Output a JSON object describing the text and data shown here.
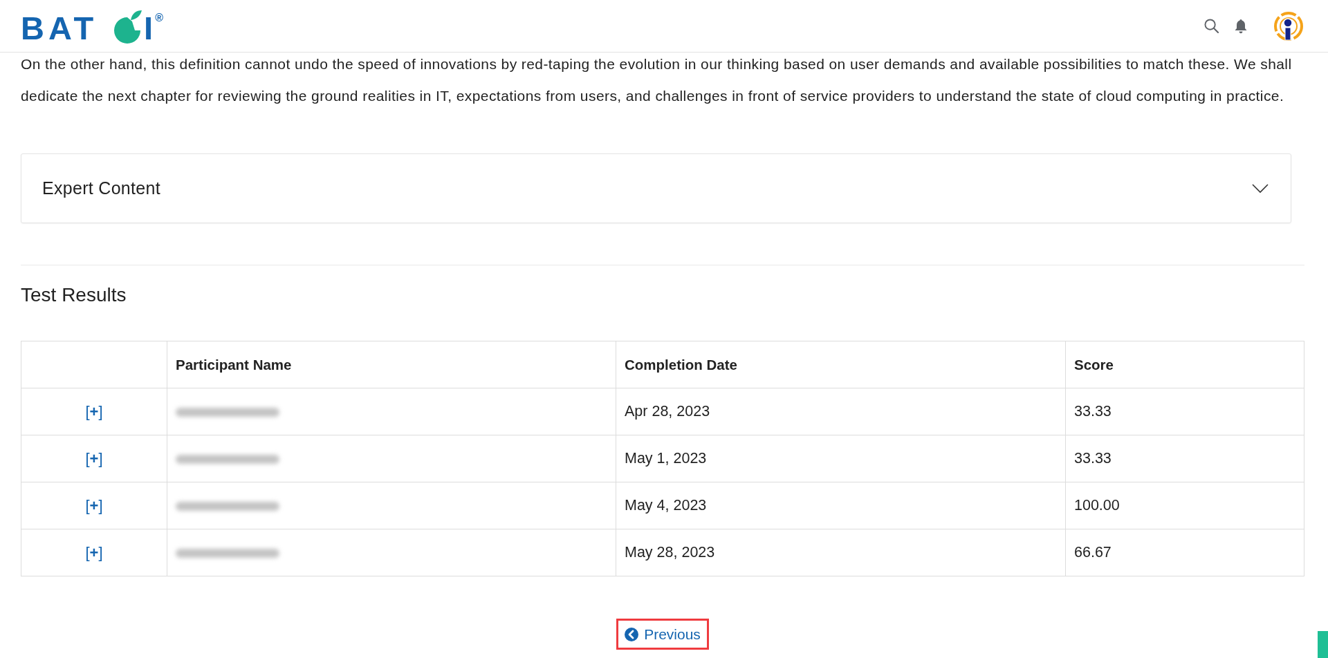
{
  "header": {
    "logo": {
      "left": "BAT",
      "right": "I",
      "mark": "®"
    }
  },
  "paragraph": "On the other hand, this definition cannot undo the speed of innovations by red-taping the evolution in our thinking based on user demands and available possibilities to match these. We shall dedicate the next chapter for reviewing the ground realities in IT, expectations from users, and challenges in front of service providers to understand the state of cloud computing in practice.",
  "accordion": {
    "title": "Expert Content",
    "expanded": false
  },
  "section_title": "Test Results",
  "table": {
    "columns": [
      "Participant Name",
      "Completion Date",
      "Score"
    ],
    "rows": [
      {
        "expand": "[**+**]",
        "name_blurred": true,
        "date": "Apr 28, 2023",
        "score": "33.33"
      },
      {
        "expand": "[**+**]",
        "name_blurred": true,
        "date": "May 1, 2023",
        "score": "33.33"
      },
      {
        "expand": "[**+**]",
        "name_blurred": true,
        "date": "May 4, 2023",
        "score": "100.00"
      },
      {
        "expand": "[**+**]",
        "name_blurred": true,
        "date": "May 28, 2023",
        "score": "66.67"
      }
    ]
  },
  "pager": {
    "previous": "Previous",
    "highlighted": true
  }
}
